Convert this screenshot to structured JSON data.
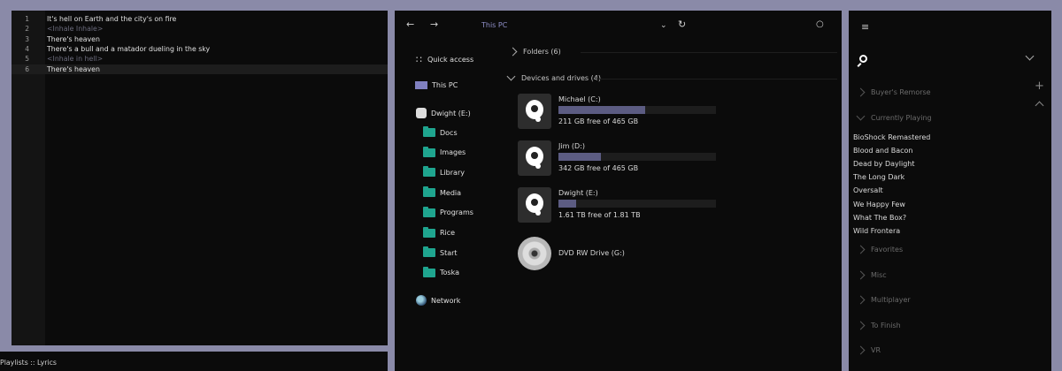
{
  "colors": {
    "background": "#8a8aa8",
    "panel": "#0b0b0b",
    "accent_address": "#8f8fc8",
    "folder": "#1fa58f",
    "drive_bar": "#5c5c82"
  },
  "editor": {
    "lines": [
      {
        "num": "1",
        "text": "It's hell on Earth and the city's on fire"
      },
      {
        "num": "2",
        "text": "<Inhale Inhale>"
      },
      {
        "num": "3",
        "text": "There's heaven"
      },
      {
        "num": "4",
        "text": "There's a bull and a matador dueling in the sky"
      },
      {
        "num": "5",
        "text": "<Inhale in hell>"
      },
      {
        "num": "6",
        "text": "There's heaven"
      }
    ]
  },
  "statusbar": {
    "text": "Playlists :: Lyrics"
  },
  "explorer": {
    "back_icon": "back-arrow-icon",
    "forward_icon": "forward-arrow-icon",
    "address": "This PC",
    "sidebar": {
      "quick_access": "Quick access",
      "this_pc": "This PC",
      "drive": "Dwight (E:)",
      "folders": [
        "Docs",
        "Images",
        "Library",
        "Media",
        "Programs",
        "Rice",
        "Start",
        "Toska"
      ],
      "network": "Network"
    },
    "folders_header": "Folders (6)",
    "devices_header": "Devices and drives (4)",
    "drives": [
      {
        "name": "Michael (C:)",
        "free": "211 GB free of 465 GB",
        "used_fraction": 0.55
      },
      {
        "name": "Jim (D:)",
        "free": "342 GB free of 465 GB",
        "used_fraction": 0.27
      },
      {
        "name": "Dwight (E:)",
        "free": "1.61 TB free of 1.81 TB",
        "used_fraction": 0.11
      }
    ],
    "dvd": "DVD RW Drive (G:)"
  },
  "playlist": {
    "menu_icon": "hamburger-icon",
    "search_icon": "search-icon",
    "add_symbol": "+",
    "categories_top": [
      "Buyer's Remorse",
      "Currently Playing"
    ],
    "items": [
      "BioShock Remastered",
      "Blood and Bacon",
      "Dead by Daylight",
      "The Long Dark",
      "Oversalt",
      "We Happy Few",
      "What The Box?",
      "Wild Frontera"
    ],
    "categories_bottom": [
      "Favorites",
      "Misc",
      "Multiplayer",
      "To Finish",
      "VR"
    ]
  }
}
